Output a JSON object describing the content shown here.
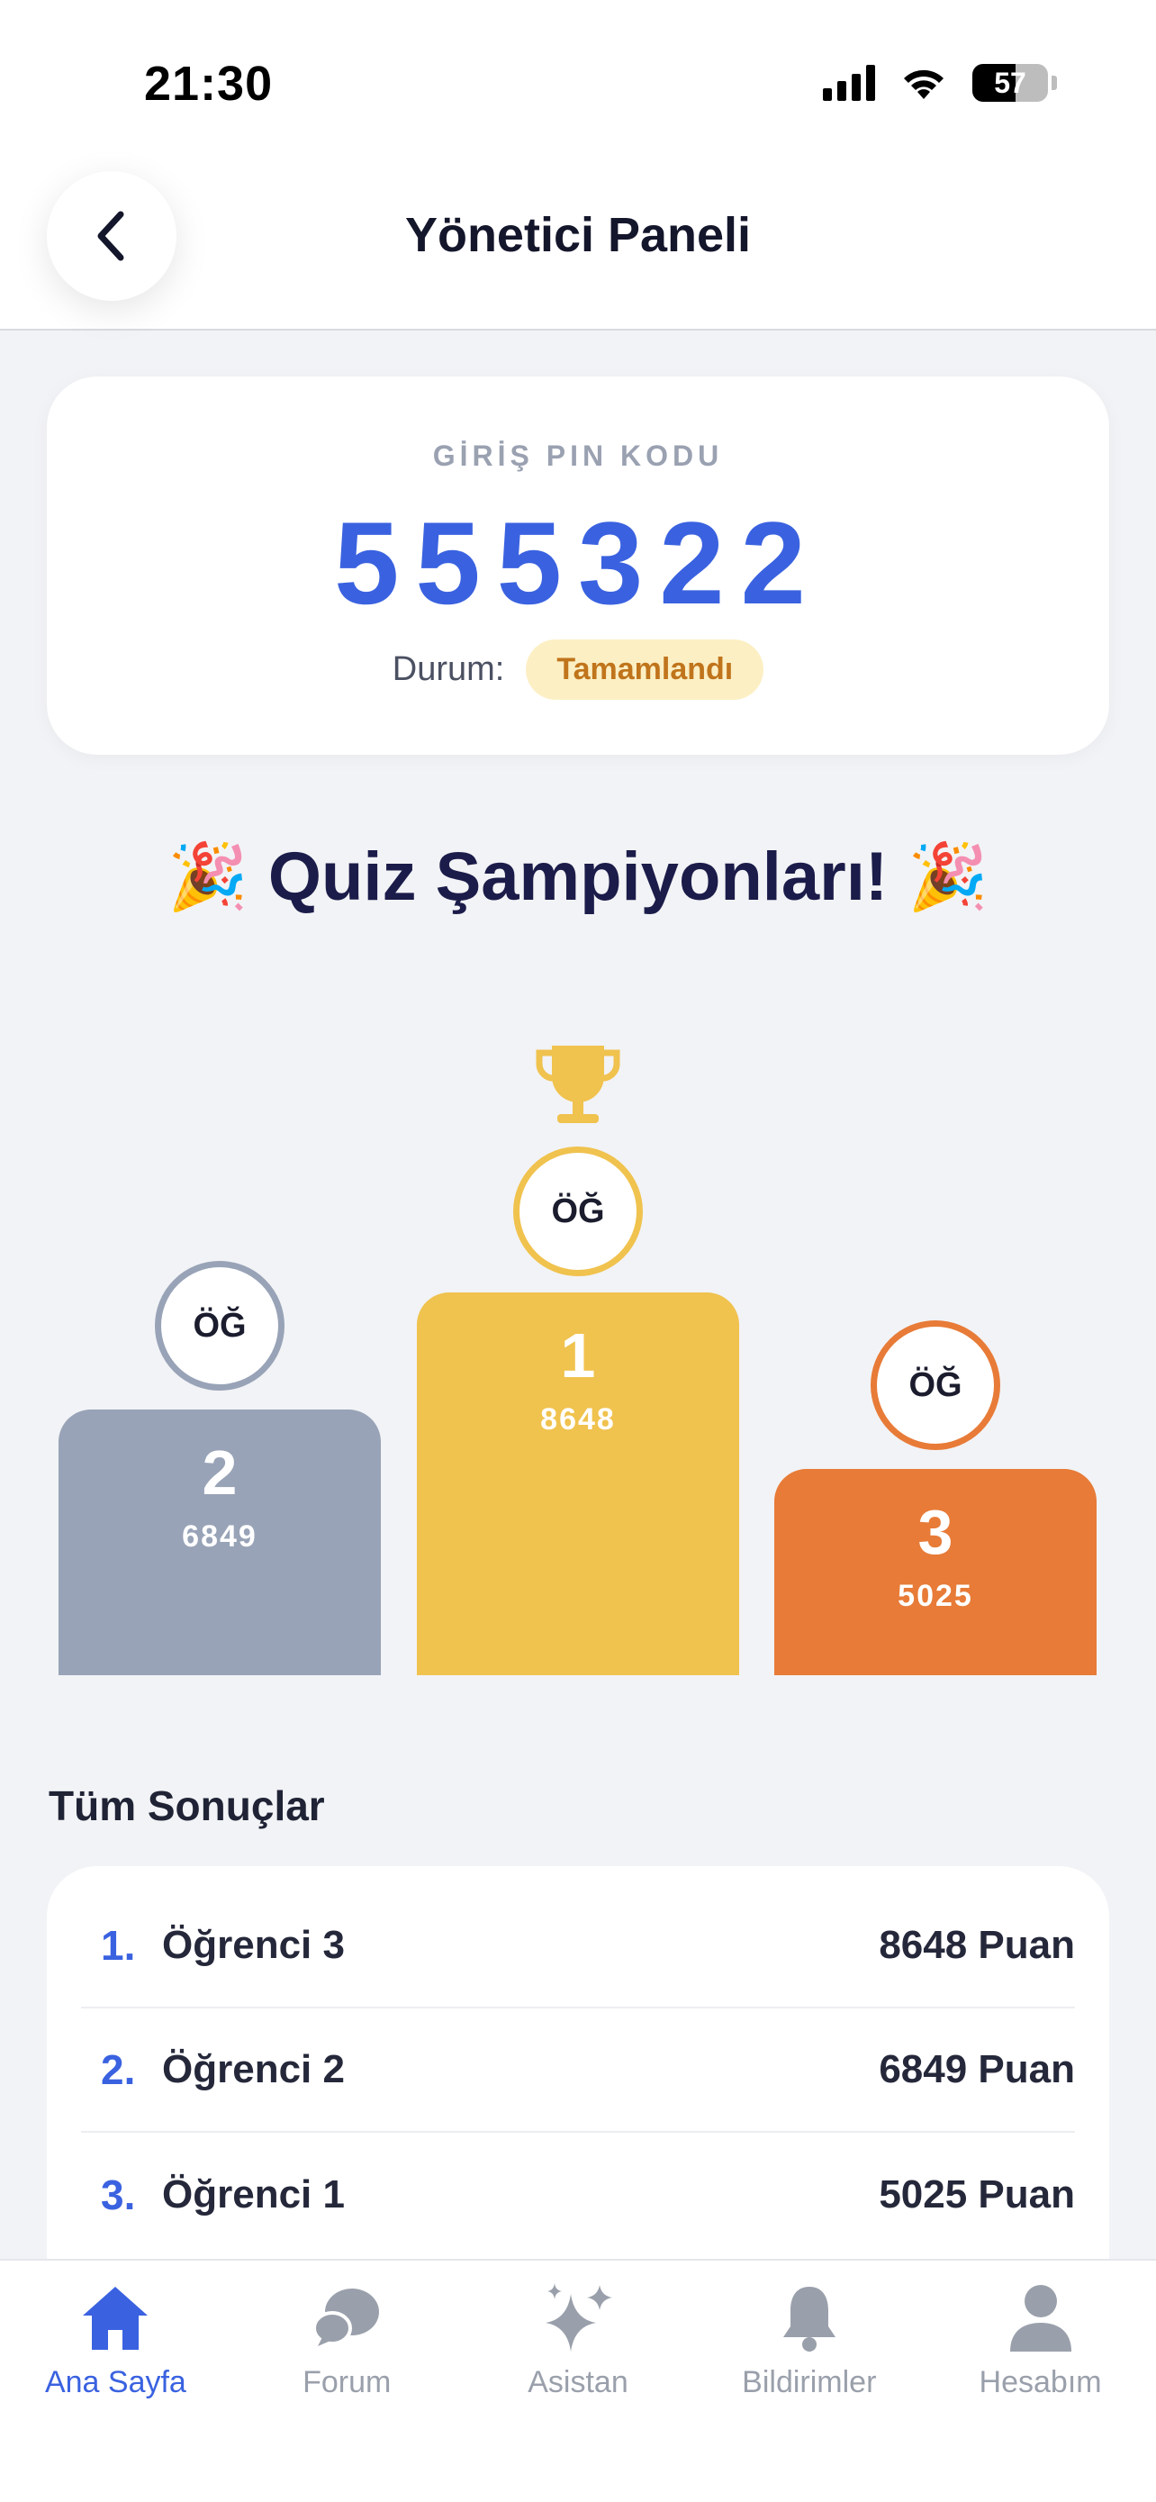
{
  "status_bar": {
    "time": "21:30",
    "battery": "57"
  },
  "header": {
    "title": "Yönetici Paneli"
  },
  "pin_card": {
    "label": "GİRİŞ PIN KODU",
    "code": "555322",
    "status_label": "Durum:",
    "status_value": "Tamamlandı"
  },
  "champions": {
    "title": "Quiz Şampiyonları!",
    "emoji": "🎉",
    "podium": [
      {
        "rank": "2",
        "score": "6849",
        "avatar": "ÖĞ",
        "color": "#98a3b7"
      },
      {
        "rank": "1",
        "score": "8648",
        "avatar": "ÖĞ",
        "color": "#f0c24e"
      },
      {
        "rank": "3",
        "score": "5025",
        "avatar": "ÖĞ",
        "color": "#e77b37"
      }
    ]
  },
  "results": {
    "title": "Tüm Sonuçlar",
    "rows": [
      {
        "no": "1.",
        "name": "Öğrenci 3",
        "points": "8648 Puan"
      },
      {
        "no": "2.",
        "name": "Öğrenci 2",
        "points": "6849 Puan"
      },
      {
        "no": "3.",
        "name": "Öğrenci 1",
        "points": "5025 Puan"
      }
    ]
  },
  "nav": {
    "items": [
      {
        "label": "Ana Sayfa",
        "icon": "home-icon",
        "active": true
      },
      {
        "label": "Forum",
        "icon": "chat-icon",
        "active": false
      },
      {
        "label": "Asistan",
        "icon": "sparkle-icon",
        "active": false
      },
      {
        "label": "Bildirimler",
        "icon": "bell-icon",
        "active": false
      },
      {
        "label": "Hesabım",
        "icon": "person-icon",
        "active": false
      }
    ],
    "active_color": "#3a62e0",
    "inactive_color": "#9aa0ab"
  }
}
